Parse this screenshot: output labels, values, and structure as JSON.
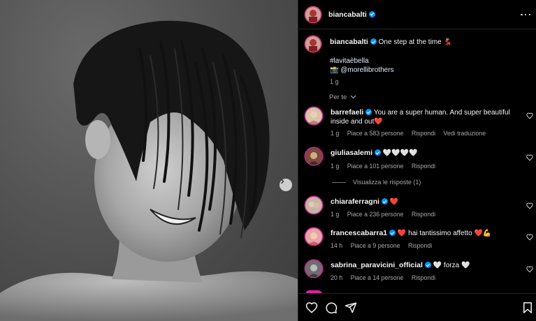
{
  "post": {
    "username": "biancabalti",
    "verified": true
  },
  "caption": {
    "username": "biancabalti",
    "text": "One step at the time",
    "emoji": "💃🏻",
    "hashtag": "#lavitaèbella",
    "camera_emoji": "📸",
    "credit": "@morellibrothers",
    "time": "1 g"
  },
  "for_you_label": "Per te",
  "comments": [
    {
      "username": "barrefaeli",
      "verified": true,
      "text": "You are a super human. And super beautiful inside and out",
      "emoji": "❤️",
      "time": "1 g",
      "likes": "Piace a 583 persone",
      "reply": "Rispondi",
      "translate": "Vedi traduzione"
    },
    {
      "username": "giuliasalemi",
      "verified": true,
      "text": "",
      "emoji": "🤍🤍🤍🤍",
      "time": "1 g",
      "likes": "Piace a 101 persone",
      "reply": "Rispondi",
      "view_replies": "Visualizza le risposte (1)"
    },
    {
      "username": "chiaraferragni",
      "verified": true,
      "text": "",
      "emoji": "❤️",
      "time": "1 g",
      "likes": "Piace a 236 persone",
      "reply": "Rispondi"
    },
    {
      "username": "francescabarra1",
      "verified": true,
      "text": "hai tantissimo affetto",
      "emoji_before": "❤️",
      "emoji": "❤️💪",
      "time": "14 h",
      "likes": "Piace a 9 persone",
      "reply": "Rispondi"
    },
    {
      "username": "sabrina_paravicini_official",
      "verified": true,
      "text": "forza",
      "emoji_before": "🤍",
      "emoji": "🤍",
      "time": "20 h",
      "likes": "Piace a 14 persone",
      "reply": "Rispondi"
    }
  ],
  "icons": {
    "like": "heart-icon",
    "comment": "comment-icon",
    "share": "share-icon",
    "save": "bookmark-icon",
    "more": "more-icon",
    "next": "chevron-right-icon"
  },
  "colors": {
    "verified": "#0095f6",
    "background": "#000000",
    "muted_text": "#a8a8a8",
    "story_ring": "#d6249f"
  }
}
